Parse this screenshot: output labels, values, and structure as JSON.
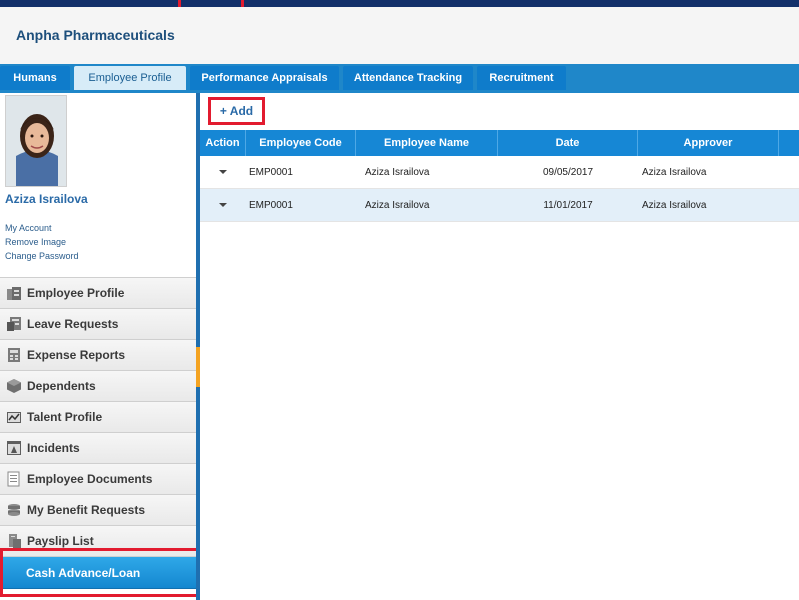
{
  "app": {
    "title": "Anpha Pharmaceuticals"
  },
  "tabs": [
    "Humans",
    "Employee Profile",
    "Performance Appraisals",
    "Attendance Tracking",
    "Recruitment"
  ],
  "active_tab": "Employee Profile",
  "user": {
    "name": "Aziza Israilova",
    "links": [
      "My Account",
      "Remove Image",
      "Change Password"
    ]
  },
  "menu": {
    "items": [
      {
        "label": "Employee Profile",
        "icon": "employee-profile-icon"
      },
      {
        "label": "Leave Requests",
        "icon": "leave-requests-icon"
      },
      {
        "label": "Expense Reports",
        "icon": "expense-reports-icon"
      },
      {
        "label": "Dependents",
        "icon": "dependents-icon"
      },
      {
        "label": "Talent Profile",
        "icon": "talent-profile-icon"
      },
      {
        "label": "Incidents",
        "icon": "incidents-icon"
      },
      {
        "label": "Employee Documents",
        "icon": "employee-documents-icon"
      },
      {
        "label": "My Benefit Requests",
        "icon": "benefit-requests-icon"
      },
      {
        "label": "Payslip List",
        "icon": "payslip-icon"
      },
      {
        "label": "Cash Advance/Loan",
        "icon": "cash-advance-icon"
      }
    ],
    "selected": "Cash Advance/Loan"
  },
  "toolbar": {
    "add_label": "+ Add"
  },
  "grid": {
    "columns": [
      "Action",
      "Employee Code",
      "Employee Name",
      "Date",
      "Approver"
    ],
    "rows": [
      {
        "code": "EMP0001",
        "name": "Aziza Israilova",
        "date": "09/05/2017",
        "approver": "Aziza Israilova"
      },
      {
        "code": "EMP0001",
        "name": "Aziza Israilova",
        "date": "11/01/2017",
        "approver": "Aziza Israilova"
      }
    ]
  },
  "colors": {
    "accent": "#1687d5",
    "nav_dark": "#13306a",
    "highlight": "#e21b2f",
    "selected_menu": "#1f95db"
  }
}
